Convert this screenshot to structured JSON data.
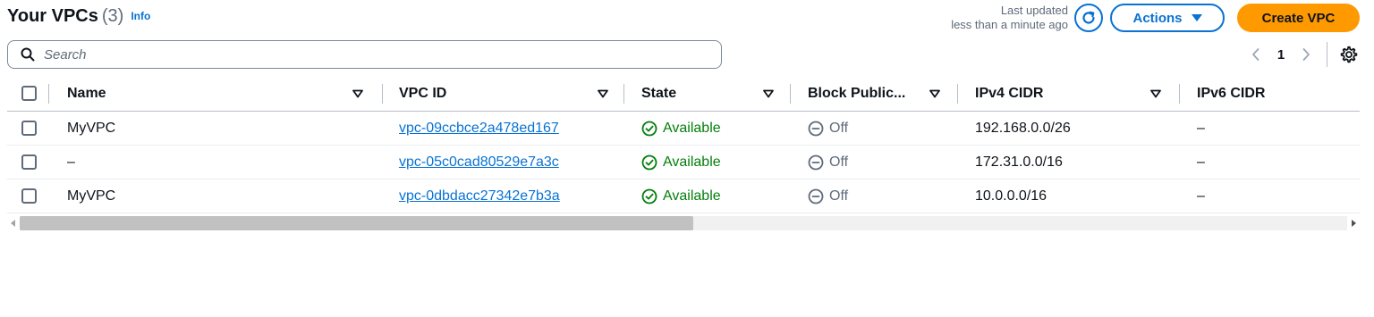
{
  "header": {
    "title": "Your VPCs",
    "count": "(3)",
    "info": "Info",
    "last_updated_line1": "Last updated",
    "last_updated_line2": "less than a minute ago",
    "actions_label": "Actions",
    "create_label": "Create VPC"
  },
  "search": {
    "placeholder": "Search"
  },
  "pagination": {
    "current_page": "1"
  },
  "table": {
    "columns": [
      "Name",
      "VPC ID",
      "State",
      "Block Public...",
      "IPv4 CIDR",
      "IPv6 CIDR"
    ],
    "rows": [
      {
        "name": "MyVPC",
        "vpc_id": "vpc-09ccbce2a478ed167",
        "state": "Available",
        "block_public": "Off",
        "ipv4": "192.168.0.0/26",
        "ipv6": "–"
      },
      {
        "name": "–",
        "vpc_id": "vpc-05c0cad80529e7a3c",
        "state": "Available",
        "block_public": "Off",
        "ipv4": "172.31.0.0/16",
        "ipv6": "–"
      },
      {
        "name": "MyVPC",
        "vpc_id": "vpc-0dbdacc27342e7b3a",
        "state": "Available",
        "block_public": "Off",
        "ipv4": "10.0.0.0/16",
        "ipv6": "–"
      }
    ]
  },
  "colors": {
    "link": "#0972d3",
    "primary_button": "#ff9900",
    "success": "#037f0c",
    "muted": "#5f6b7a"
  },
  "icons": [
    "info-link",
    "refresh-icon",
    "caret-down-icon",
    "search-icon",
    "chevron-left-icon",
    "chevron-right-icon",
    "settings-gear-icon",
    "sort-caret-icon",
    "status-available-icon",
    "status-off-icon"
  ]
}
